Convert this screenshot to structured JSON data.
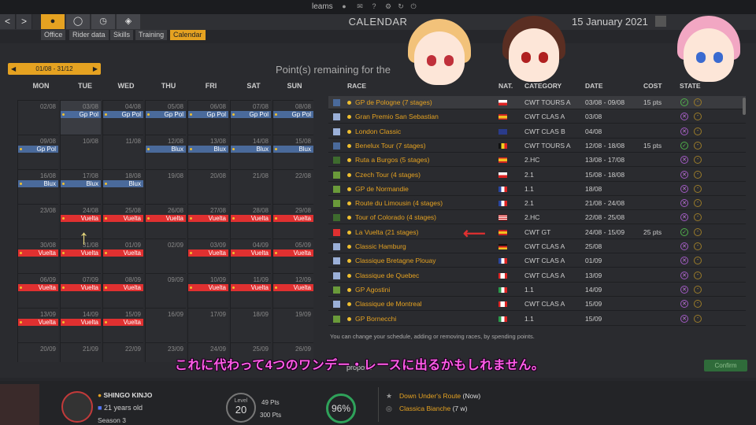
{
  "app": {
    "window_title": "leams"
  },
  "nav": {
    "back": "<",
    "forward": ">",
    "page_title": "CALENDAR",
    "date": "15 January 2021",
    "subtabs": [
      "Office",
      "Rider data",
      "Skills",
      "Training",
      "Calendar"
    ],
    "active_subtab": "Calendar"
  },
  "calendar": {
    "period": "01/08 - 31/12",
    "points_remaining": "Point(s) remaining for the",
    "days": [
      "MON",
      "TUE",
      "WED",
      "THU",
      "FRI",
      "SAT",
      "SUN"
    ],
    "weeks": [
      {
        "dates": [
          "02/08",
          "03/08",
          "04/08",
          "05/08",
          "06/08",
          "07/08",
          "08/08"
        ],
        "events": [
          "",
          "Gp Pol",
          "Gp Pol",
          "Gp Pol",
          "Gp Pol",
          "Gp Pol",
          "Gp Pol"
        ],
        "color": "blue"
      },
      {
        "dates": [
          "09/08",
          "10/08",
          "11/08",
          "12/08",
          "13/08",
          "14/08",
          "15/08"
        ],
        "events": [
          "Gp Pol",
          "",
          "",
          "Blux",
          "Blux",
          "Blux",
          "Blux"
        ],
        "color": "blue"
      },
      {
        "dates": [
          "16/08",
          "17/08",
          "18/08",
          "19/08",
          "20/08",
          "21/08",
          "22/08"
        ],
        "events": [
          "Blux",
          "Blux",
          "Blux",
          "",
          "",
          "",
          ""
        ],
        "color": "blue"
      },
      {
        "dates": [
          "23/08",
          "24/08",
          "25/08",
          "26/08",
          "27/08",
          "28/08",
          "29/08"
        ],
        "events": [
          "",
          "Vuelta",
          "Vuelta",
          "Vuelta",
          "Vuelta",
          "Vuelta",
          "Vuelta"
        ],
        "color": "red"
      },
      {
        "dates": [
          "30/08",
          "31/08",
          "01/09",
          "02/09",
          "03/09",
          "04/09",
          "05/09"
        ],
        "events": [
          "Vuelta",
          "Vuelta",
          "Vuelta",
          "",
          "Vuelta",
          "Vuelta",
          "Vuelta"
        ],
        "color": "red"
      },
      {
        "dates": [
          "06/09",
          "07/09",
          "08/09",
          "09/09",
          "10/09",
          "11/09",
          "12/09"
        ],
        "events": [
          "Vuelta",
          "Vuelta",
          "Vuelta",
          "",
          "Vuelta",
          "Vuelta",
          "Vuelta"
        ],
        "color": "red"
      },
      {
        "dates": [
          "13/09",
          "14/09",
          "15/09",
          "16/09",
          "17/09",
          "18/09",
          "19/09"
        ],
        "events": [
          "Vuelta",
          "Vuelta",
          "Vuelta",
          "",
          "",
          "",
          ""
        ],
        "color": "red"
      },
      {
        "dates": [
          "20/09",
          "21/09",
          "22/09",
          "23/09",
          "24/09",
          "25/09",
          "26/09"
        ],
        "events": [
          "",
          "",
          "",
          "",
          "",
          "",
          ""
        ],
        "color": "red"
      }
    ]
  },
  "races": {
    "headers": {
      "race": "RACE",
      "nat": "NAT.",
      "category": "CATEGORY",
      "date": "DATE",
      "cost": "COST",
      "state": "STATE"
    },
    "rows": [
      {
        "name": "GP de Pologne (7 stages)",
        "category": "CWT TOURS A",
        "date": "03/08 - 09/08",
        "cost": "15 pts",
        "state": "ok",
        "sq": "#4a6a9b",
        "flag": "pl"
      },
      {
        "name": "Gran Premio San Sebastian",
        "category": "CWT CLAS A",
        "date": "03/08",
        "cost": "",
        "state": "x",
        "sq": "#9bb0d8",
        "flag": "es"
      },
      {
        "name": "London Classic",
        "category": "CWT CLAS B",
        "date": "04/08",
        "cost": "",
        "state": "x",
        "sq": "#9bb0d8",
        "flag": "gb"
      },
      {
        "name": "Benelux Tour (7 stages)",
        "category": "CWT TOURS A",
        "date": "12/08 - 18/08",
        "cost": "15 pts",
        "state": "ok",
        "sq": "#4a6a9b",
        "flag": "be"
      },
      {
        "name": "Ruta a Burgos (5 stages)",
        "category": "2.HC",
        "date": "13/08 - 17/08",
        "cost": "",
        "state": "x",
        "sq": "#3e6b2e",
        "flag": "es"
      },
      {
        "name": "Czech Tour (4 stages)",
        "category": "2.1",
        "date": "15/08 - 18/08",
        "cost": "",
        "state": "x",
        "sq": "#6a9a3a",
        "flag": "cz"
      },
      {
        "name": "GP de Normandie",
        "category": "1.1",
        "date": "18/08",
        "cost": "",
        "state": "x",
        "sq": "#6a9a3a",
        "flag": "fr"
      },
      {
        "name": "Route du Limousin (4 stages)",
        "category": "2.1",
        "date": "21/08 - 24/08",
        "cost": "",
        "state": "x",
        "sq": "#6a9a3a",
        "flag": "fr"
      },
      {
        "name": "Tour of Colorado (4 stages)",
        "category": "2.HC",
        "date": "22/08 - 25/08",
        "cost": "",
        "state": "x",
        "sq": "#3e6b2e",
        "flag": "us"
      },
      {
        "name": "La Vuelta (21 stages)",
        "category": "CWT GT",
        "date": "24/08 - 15/09",
        "cost": "25 pts",
        "state": "ok",
        "sq": "#e03030",
        "flag": "es"
      },
      {
        "name": "Classic Hamburg",
        "category": "CWT CLAS A",
        "date": "25/08",
        "cost": "",
        "state": "x",
        "sq": "#9bb0d8",
        "flag": "de"
      },
      {
        "name": "Classique Bretagne Plouay",
        "category": "CWT CLAS A",
        "date": "01/09",
        "cost": "",
        "state": "x",
        "sq": "#9bb0d8",
        "flag": "fr"
      },
      {
        "name": "Classique de Quebec",
        "category": "CWT CLAS A",
        "date": "13/09",
        "cost": "",
        "state": "x",
        "sq": "#9bb0d8",
        "flag": "ca"
      },
      {
        "name": "GP Agostini",
        "category": "1.1",
        "date": "14/09",
        "cost": "",
        "state": "x",
        "sq": "#6a9a3a",
        "flag": "it"
      },
      {
        "name": "Classique de Montreal",
        "category": "CWT CLAS A",
        "date": "15/09",
        "cost": "",
        "state": "x",
        "sq": "#9bb0d8",
        "flag": "ca"
      },
      {
        "name": "GP Bornecchi",
        "category": "1.1",
        "date": "15/09",
        "cost": "",
        "state": "x",
        "sq": "#6a9a3a",
        "flag": "it"
      }
    ],
    "hint": "You can change your schedule, adding or removing races, by spending points.",
    "propose": "proposé",
    "confirm": "Confirm"
  },
  "subtitle": "これに代わって4つのワンデー・レースに出るかもしれません。",
  "rider": {
    "name": "SHINGO KINJO",
    "age": "21 years old",
    "season": "Season 3",
    "level_label": "Level",
    "level": "20",
    "pts": "49 Pts",
    "pts_next": "300 Pts",
    "pct": "96%"
  },
  "upcoming": [
    {
      "name": "Down Under's Route",
      "note": "(Now)"
    },
    {
      "name": "Classica Bianche",
      "note": "(7 w)"
    }
  ]
}
